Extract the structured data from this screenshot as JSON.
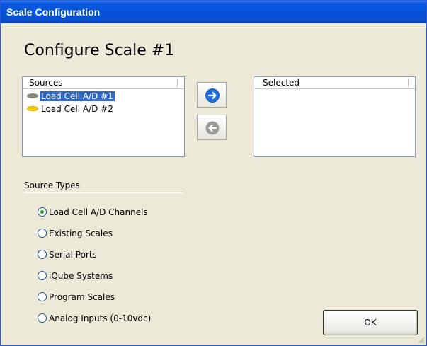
{
  "window": {
    "title": "Scale Configuration"
  },
  "heading": "Configure Scale #1",
  "sources": {
    "header": "Sources",
    "items": [
      {
        "label": "Load Cell A/D #1",
        "selected": true,
        "color": "#8a8a7a"
      },
      {
        "label": "Load Cell A/D #2",
        "selected": false,
        "color": "#f5d000"
      }
    ]
  },
  "selected_list": {
    "header": "Selected",
    "items": []
  },
  "buttons": {
    "add_icon": "arrow-right-icon",
    "remove_icon": "arrow-left-icon",
    "ok": "OK"
  },
  "source_types": {
    "label": "Source Types",
    "options": [
      {
        "label": "Load Cell A/D Channels",
        "checked": true
      },
      {
        "label": "Existing Scales",
        "checked": false
      },
      {
        "label": "Serial Ports",
        "checked": false
      },
      {
        "label": "iQube Systems",
        "checked": false
      },
      {
        "label": "Program Scales",
        "checked": false
      },
      {
        "label": "Analog Inputs (0-10vdc)",
        "checked": false
      }
    ]
  },
  "colors": {
    "titlebar": "#0553d8",
    "selection": "#316ac5",
    "add_arrow": "#1e6fe0",
    "remove_arrow": "#9a9a9a"
  }
}
